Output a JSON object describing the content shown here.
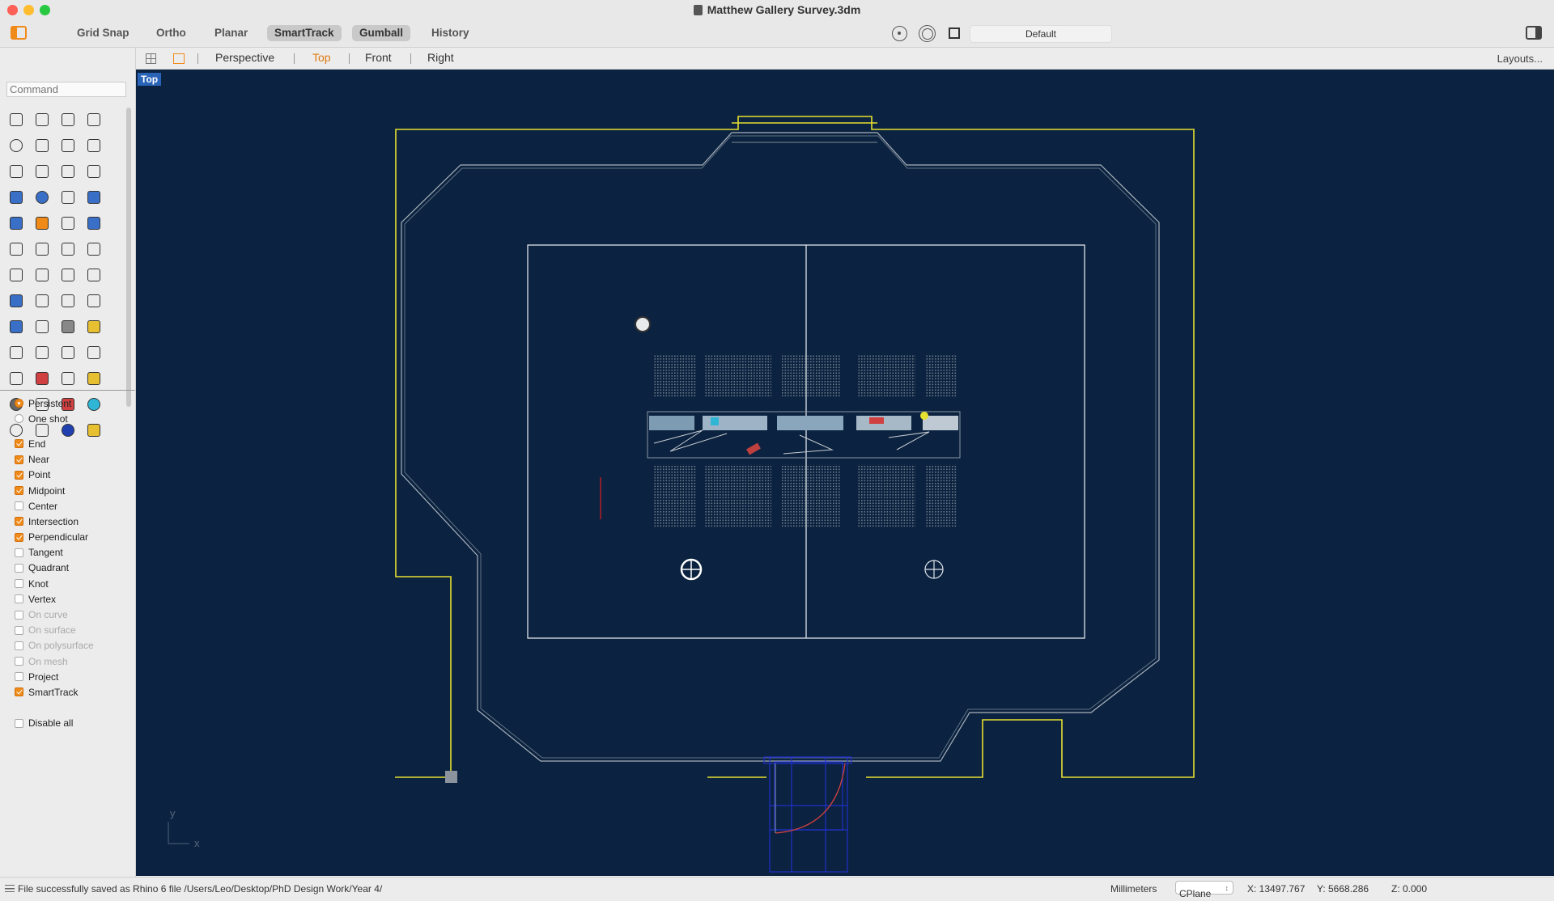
{
  "window": {
    "title": "Matthew Gallery Survey.3dm"
  },
  "toolbar": {
    "grid_snap": "Grid Snap",
    "ortho": "Ortho",
    "planar": "Planar",
    "smarttrack": "SmartTrack",
    "gumball": "Gumball",
    "history": "History",
    "layer": "Default"
  },
  "viewport_tabs": {
    "perspective": "Perspective",
    "top": "Top",
    "front": "Front",
    "right": "Right",
    "layouts": "Layouts..."
  },
  "command": {
    "placeholder": "Command"
  },
  "osnap": {
    "persistent": "Persistent",
    "one_shot": "One shot",
    "items": [
      {
        "label": "End",
        "checked": true,
        "enabled": true
      },
      {
        "label": "Near",
        "checked": true,
        "enabled": true
      },
      {
        "label": "Point",
        "checked": true,
        "enabled": true
      },
      {
        "label": "Midpoint",
        "checked": true,
        "enabled": true
      },
      {
        "label": "Center",
        "checked": false,
        "enabled": true
      },
      {
        "label": "Intersection",
        "checked": true,
        "enabled": true
      },
      {
        "label": "Perpendicular",
        "checked": true,
        "enabled": true
      },
      {
        "label": "Tangent",
        "checked": false,
        "enabled": true
      },
      {
        "label": "Quadrant",
        "checked": false,
        "enabled": true
      },
      {
        "label": "Knot",
        "checked": false,
        "enabled": true
      },
      {
        "label": "Vertex",
        "checked": false,
        "enabled": true
      },
      {
        "label": "On curve",
        "checked": false,
        "enabled": false
      },
      {
        "label": "On surface",
        "checked": false,
        "enabled": false
      },
      {
        "label": "On polysurface",
        "checked": false,
        "enabled": false
      },
      {
        "label": "On mesh",
        "checked": false,
        "enabled": false
      },
      {
        "label": "Project",
        "checked": false,
        "enabled": true
      },
      {
        "label": "SmartTrack",
        "checked": true,
        "enabled": true
      }
    ],
    "disable_all": "Disable all"
  },
  "viewport": {
    "name": "Top",
    "axis_y": "y",
    "axis_x": "x"
  },
  "status": {
    "message": "File successfully saved as Rhino 6 file /Users/Leo/Desktop/PhD Design Work/Year 4/",
    "units": "Millimeters",
    "cplane": "CPlane",
    "x": "X: 13497.767",
    "y": "Y: 5668.286",
    "z": "Z: 0.000"
  },
  "colors": {
    "viewport_bg": "#0b2340",
    "boundary": "#e6e030",
    "walls": "#aab2bc",
    "accent": "#e07a10"
  }
}
